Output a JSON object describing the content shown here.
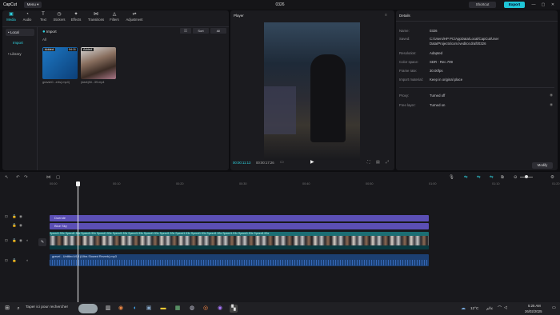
{
  "titlebar": {
    "logo": "CapCut",
    "menu_label": "Menu ▾",
    "project_title": "0326",
    "shortcut_label": "Shortcut",
    "export_label": "Export",
    "min": "—",
    "max": "▢",
    "close": "✕"
  },
  "media_toolbar": {
    "tabs": [
      {
        "label": "Media",
        "icon": "media-icon"
      },
      {
        "label": "Audio",
        "icon": "audio-icon"
      },
      {
        "label": "Text",
        "icon": "text-icon"
      },
      {
        "label": "Stickers",
        "icon": "stickers-icon"
      },
      {
        "label": "Effects",
        "icon": "effects-icon"
      },
      {
        "label": "Transitions",
        "icon": "transitions-icon"
      },
      {
        "label": "Filters",
        "icon": "filters-icon"
      },
      {
        "label": "Adjustment",
        "icon": "adjustment-icon"
      }
    ]
  },
  "media_sidebar": {
    "local": "• Local",
    "import": "Import",
    "library": "• Library"
  },
  "media_main": {
    "import_label": "Import",
    "all_label": "All",
    "sort_label": "Sort",
    "filter_label": "All",
    "clips": [
      {
        "badge": "Added",
        "duration": "04:11",
        "name": "gravsh0...erts(.mp4)"
      },
      {
        "badge": "Added",
        "duration": "",
        "name": "(dark)Nt...39.mp4"
      }
    ]
  },
  "player": {
    "title": "Player",
    "current_time": "00:00:11:13",
    "total_time": "00:00:17:26"
  },
  "details": {
    "title": "Details",
    "rows": [
      {
        "label": "Name:",
        "value": "0326"
      },
      {
        "label": "Saved:",
        "value": "C:/Users/HP PC/AppData/Local/CapCut/User Data/Projects/com.lveditor.draft/0326"
      },
      {
        "label": "Resolution:",
        "value": "Adapted"
      },
      {
        "label": "Color space:",
        "value": "SDR - Rec.709"
      },
      {
        "label": "Frame rate:",
        "value": "30.00fps"
      },
      {
        "label": "Import material:",
        "value": "Keep in original place"
      },
      {
        "label": "Proxy:",
        "value": "Turned off"
      },
      {
        "label": "Free layer:",
        "value": "Turned on"
      }
    ],
    "modify_label": "Modify"
  },
  "timeline": {
    "ruler": [
      "00:00",
      "00:10",
      "00:20",
      "00:30",
      "00:40",
      "00:50",
      "01:00",
      "01:10",
      "01:20"
    ],
    "track_duende": "Duende",
    "track_bluesky": "Blue Sky",
    "speed_text": "Speed1.53x  Speed1.53x  Speed1.53x  Speed1.53x  Speed1.53x  Speed1.53x  Speed1.53x  Speed1.53x  Speed1.53x  Speed1.53x  Speed1.53x  Speed1.53x  Speed1.53x  Speed1.53x",
    "audio_label": "gravel - Untitled #13 (Ultra Slowed Reverb).mp3"
  },
  "taskbar": {
    "search_placeholder": "Taper ici pour rechercher",
    "weather": "12°C",
    "lang": "عالم",
    "time": "5:25 AM",
    "date": "26/02/2025"
  },
  "colors": {
    "accent": "#1fc5d6",
    "purple_track": "#5b4fb5",
    "video_track": "#0f4a50",
    "audio_track": "#1c3f72"
  }
}
